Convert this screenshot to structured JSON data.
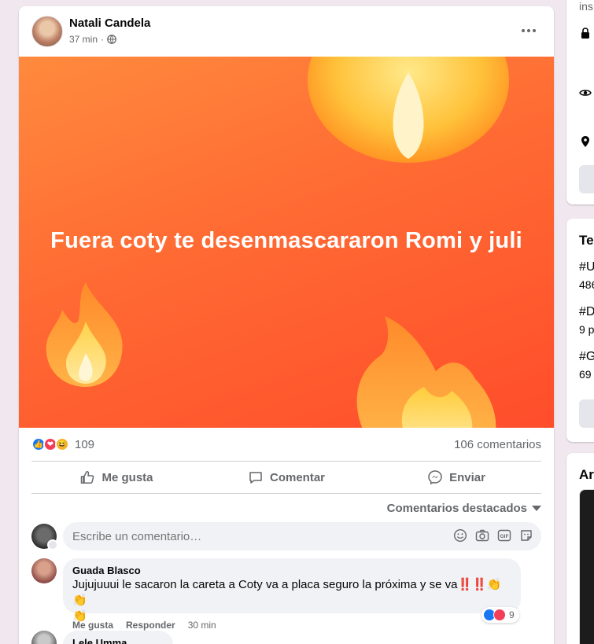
{
  "post": {
    "author": "Natali Candela",
    "time": "37 min",
    "dot": "·",
    "banner_text": "Fuera coty te desenmascararon Romi y juli",
    "banner_colors": {
      "top": "#ff8a3d",
      "bottom": "#ff4d2b"
    },
    "reaction_count": "109",
    "comments_count": "106 comentarios",
    "actions": {
      "like": "Me gusta",
      "comment": "Comentar",
      "share": "Enviar"
    },
    "sort_label": "Comentarios destacados",
    "comment_placeholder": "Escribe un comentario…"
  },
  "comments": [
    {
      "author": "Guada Blasco",
      "text": "Jujujuuui le sacaron la careta a Coty va a placa seguro la próxima y se va",
      "emoji": "‼️‼️👏👏",
      "emoji_wrap": "👏",
      "like_label": "Me gusta",
      "reply_label": "Responder",
      "time": "30 min",
      "reaction_count": "9"
    },
    {
      "author": "Lele Umma"
    }
  ],
  "sidebar": {
    "about": {
      "intro_text": "ins"
    },
    "trending": {
      "title": "Ter",
      "items": [
        {
          "tag": "#U",
          "count": "486"
        },
        {
          "tag": "#D",
          "count": "9 p"
        },
        {
          "tag": "#G",
          "count": "69"
        }
      ]
    },
    "third": {
      "title": "Are"
    }
  },
  "colors": {
    "accent": "#1877f2",
    "love": "#f33e58",
    "haha": "#f7b125",
    "muted": "#65676b"
  },
  "icons": [
    "globe-icon",
    "more-icon",
    "like-icon",
    "comment-icon",
    "messenger-icon",
    "emoji-icon",
    "camera-icon",
    "gif-icon",
    "sticker-icon",
    "lock-icon",
    "eye-icon",
    "location-icon",
    "caret-down-icon"
  ]
}
